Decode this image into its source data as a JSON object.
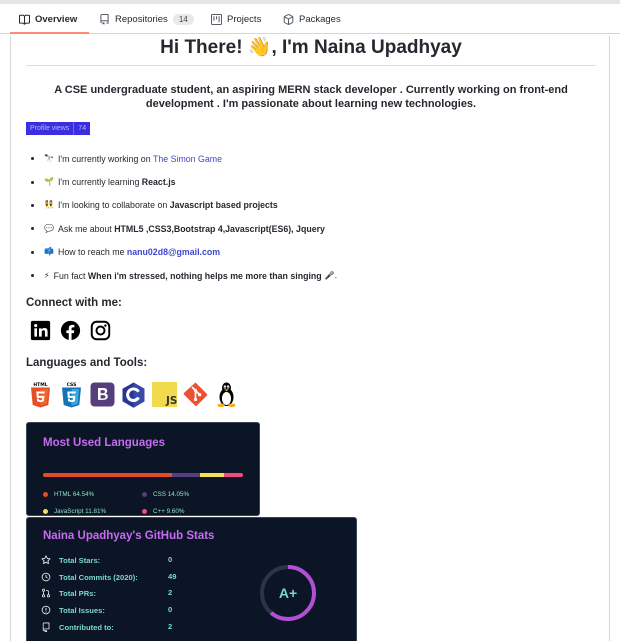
{
  "tabs": [
    {
      "label": "Overview",
      "icon": "book-icon",
      "active": true
    },
    {
      "label": "Repositories",
      "icon": "repo-icon",
      "count": "14"
    },
    {
      "label": "Projects",
      "icon": "project-icon"
    },
    {
      "label": "Packages",
      "icon": "package-icon"
    }
  ],
  "readme": {
    "title": "Hi There! 👋, I'm Naina Upadhyay",
    "intro": "A CSE undergraduate student, an aspiring MERN stack developer . Currently working on front-end development . I'm passionate about learning new technologies.",
    "badge": {
      "label": "Profile views",
      "value": "74"
    },
    "items": [
      {
        "emoji": "🔭",
        "text": "I'm currently working on ",
        "link": "The Simon Game"
      },
      {
        "emoji": "🌱",
        "text": "I'm currently learning ",
        "strong": "React.js"
      },
      {
        "emoji": "👯",
        "text": "I'm looking to collaborate on ",
        "strong": "Javascript based projects"
      },
      {
        "emoji": "💬",
        "text": "Ask me about ",
        "strong": "HTML5 ,CSS3,Bootstrap 4,Javascript(ES6), Jquery"
      },
      {
        "emoji": "📫",
        "text": "How to reach me ",
        "link_strong": "nanu02d8@gmail.com"
      },
      {
        "emoji": "⚡",
        "text": "Fun fact ",
        "strong": "When i'm stressed, nothing helps me more than singing",
        "tail": "🎤."
      }
    ],
    "connect_heading": "Connect with me:",
    "social": [
      "linkedin-icon",
      "facebook-icon",
      "instagram-icon"
    ],
    "languages_heading": "Languages and Tools:",
    "tools": [
      "html5",
      "css3",
      "bootstrap",
      "c",
      "javascript",
      "git",
      "linux"
    ]
  },
  "languages_card": {
    "title": "Most Used Languages",
    "items": [
      {
        "name": "HTML",
        "percent": "64.54%",
        "color": "#e34c26"
      },
      {
        "name": "CSS",
        "percent": "14.05%",
        "color": "#563d7c"
      },
      {
        "name": "JavaScript",
        "percent": "11.81%",
        "color": "#f1e05a"
      },
      {
        "name": "C++",
        "percent": "9.60%",
        "color": "#f34b7d"
      }
    ]
  },
  "stats_card": {
    "title": "Naina Upadhyay's GitHub Stats",
    "rows": [
      {
        "label": "Total Stars:",
        "value": "0",
        "icon": "star-icon"
      },
      {
        "label": "Total Commits (2020):",
        "value": "49",
        "icon": "history-icon"
      },
      {
        "label": "Total PRs:",
        "value": "2",
        "icon": "pull-request-icon"
      },
      {
        "label": "Total Issues:",
        "value": "0",
        "icon": "issue-icon"
      },
      {
        "label": "Contributed to:",
        "value": "2",
        "icon": "repo-icon"
      }
    ],
    "rank": "A+",
    "colors": {
      "title": "#c66cf0",
      "text": "#79d8c8",
      "ring": "#b34fd6",
      "bg": "#0c1526"
    }
  }
}
